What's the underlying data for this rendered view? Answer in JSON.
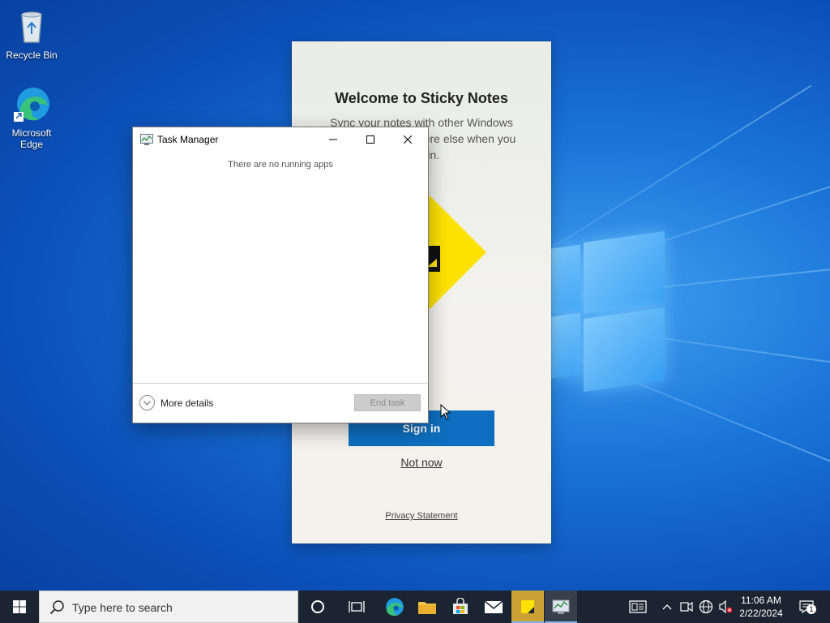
{
  "desktop": {
    "icons": [
      {
        "label": "Recycle Bin"
      },
      {
        "label": "Microsoft Edge"
      }
    ]
  },
  "sticky_notes": {
    "title": "Welcome to Sticky Notes",
    "description": "Sync your notes with other Windows devices and anywhere else when you sign in.",
    "sign_in_label": "Sign in",
    "not_now_label": "Not now",
    "privacy_label": "Privacy Statement",
    "accent_color": "#fde200",
    "button_color": "#0e6fc0"
  },
  "task_manager": {
    "title": "Task Manager",
    "empty_message": "There are no running apps",
    "more_details_label": "More details",
    "end_task_label": "End task"
  },
  "taskbar": {
    "search_placeholder": "Type here to search",
    "pinned": [
      "cortana-icon",
      "task-view-icon",
      "edge-icon",
      "file-explorer-icon",
      "store-icon",
      "mail-icon",
      "sticky-notes-icon",
      "task-manager-icon"
    ],
    "time": "11:06 AM",
    "date": "2/22/2024",
    "notification_count": "1",
    "background_color": "#1b2532"
  }
}
